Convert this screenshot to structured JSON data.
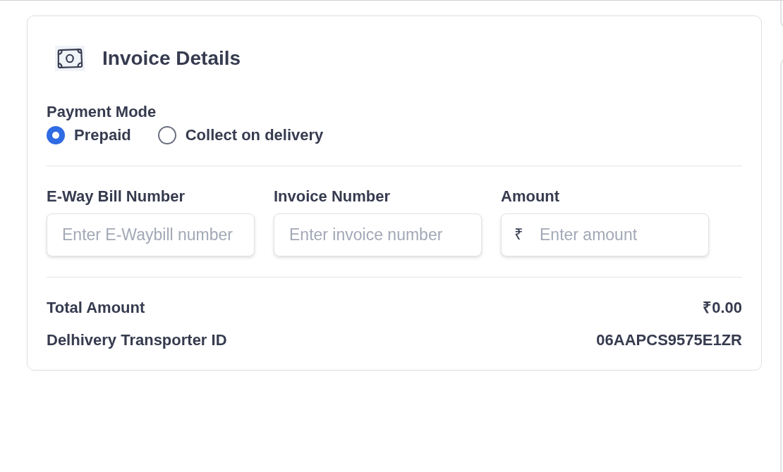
{
  "card": {
    "title": "Invoice Details",
    "payment_mode": {
      "label": "Payment Mode",
      "options": [
        {
          "label": "Prepaid",
          "selected": true
        },
        {
          "label": "Collect on delivery",
          "selected": false
        }
      ]
    },
    "fields": [
      {
        "label": "E-Way Bill Number",
        "placeholder": "Enter E-Waybill number"
      },
      {
        "label": "Invoice Number",
        "placeholder": "Enter invoice number"
      },
      {
        "label": "Amount",
        "prefix": "₹",
        "placeholder": "Enter amount"
      }
    ],
    "summary": [
      {
        "label": "Total Amount",
        "value": "₹0.00"
      },
      {
        "label": "Delhivery Transporter ID",
        "value": "06AAPCS9575E1ZR"
      }
    ]
  }
}
